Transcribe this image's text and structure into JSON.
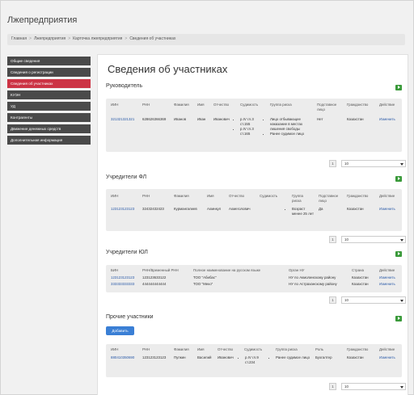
{
  "app_title": "Лжепредприятия",
  "breadcrumb": [
    "Главная",
    "Лжепредприятия",
    "Карточка лжепредприятия",
    "Сведения об участниках"
  ],
  "breadcrumb_sep": ">",
  "sidebar": {
    "items": [
      {
        "label": "Общие сведения",
        "active": false
      },
      {
        "label": "Сведения о регистрации",
        "active": false
      },
      {
        "label": "Сведения об участниках",
        "active": true
      },
      {
        "label": "КУЭН",
        "active": false
      },
      {
        "label": "УД",
        "active": false
      },
      {
        "label": "Контрагенты",
        "active": false
      },
      {
        "label": "Движение денежных средств",
        "active": false
      },
      {
        "label": "Дополнительная информация",
        "active": false
      }
    ]
  },
  "page_title": "Сведения об участниках",
  "leader": {
    "title": "Руководитель",
    "headers": [
      "ИИН",
      "РНН",
      "Фамилия",
      "Имя",
      "Отчество",
      "Судимость",
      "Группа риска",
      "Подставное лицо",
      "Гражданство",
      "Действие"
    ],
    "row": {
      "iin": "321321321321",
      "rnn": "628626366369",
      "surname": "Иванов",
      "name": "Иван",
      "patronymic": "Иванович",
      "convictions": [
        "р.IV гл.3 ст.155",
        "р.IV гл.3 ст.165"
      ],
      "risk_group": [
        "Лицо отбывающее наказание в местах лишения свободы",
        "Ранее судимое лицо"
      ],
      "nominee": "Нет",
      "citizenship": "Казахстан",
      "action": "Изменить"
    },
    "page": "1",
    "page_size": "10"
  },
  "founders_fl": {
    "title": "Учредители ФЛ",
    "headers": [
      "ИИН",
      "РНН",
      "Фамилия",
      "Имя",
      "Отчество",
      "Судимость",
      "Группа риска",
      "Подставное лицо",
      "Гражданство",
      "Действие"
    ],
    "row": {
      "iin": "123123123123",
      "rnn": "32432432423",
      "surname": "Курмангалиев",
      "name": "Ахмнкул",
      "patronymic": "Ахмеголович",
      "risk_group": [
        "Возраст менее 25 лет"
      ],
      "nominee": "Да",
      "citizenship": "Казахстан",
      "action": "Изменить"
    },
    "page": "1",
    "page_size": "10"
  },
  "founders_ul": {
    "title": "Учредители ЮЛ",
    "headers": [
      "БИН",
      "РНН/Временный РНН",
      "Полное наименование на русском языке",
      "Орган НУ",
      "Страна",
      "Действие"
    ],
    "rows": [
      {
        "bin": "123123123123",
        "rnn": "123123633122",
        "name": "ТОО \"Абибас\"",
        "tax_office": "НУ по Акмолинскому району",
        "country": "Казахстан",
        "action": "Изменить"
      },
      {
        "bin": "333333333333",
        "rnn": "444444444444",
        "name": "ТОО \"Меко\"",
        "tax_office": "НУ по Астраханскому району",
        "country": "Казахстан",
        "action": "Изменить"
      }
    ],
    "page": "1",
    "page_size": "10"
  },
  "other": {
    "title": "Прочие участники",
    "add_label": "Добавить",
    "headers": [
      "ИИН",
      "РНН",
      "Фамилия",
      "Имя",
      "Отчество",
      "Судимость",
      "Группа риска",
      "Роль",
      "Гражданство",
      "Действие"
    ],
    "row": {
      "iin": "880410350690",
      "rnn": "123123123123",
      "surname": "Пупкин",
      "name": "Василий",
      "patronymic": "Иванович",
      "convictions": [
        "р.IV гл.9 ст.234"
      ],
      "risk_group": [
        "Ранее судимое лицо"
      ],
      "role": "Бухгалтер",
      "citizenship": "Казахстан",
      "action": "Изменить"
    },
    "page": "1",
    "page_size": "10"
  },
  "colors": {
    "active_sidebar": "#cc3344",
    "sidebar": "#4a4a4a",
    "link": "#2a5aa8",
    "expand_icon": "#3a9a3a",
    "add_button": "#3a7fd5"
  }
}
